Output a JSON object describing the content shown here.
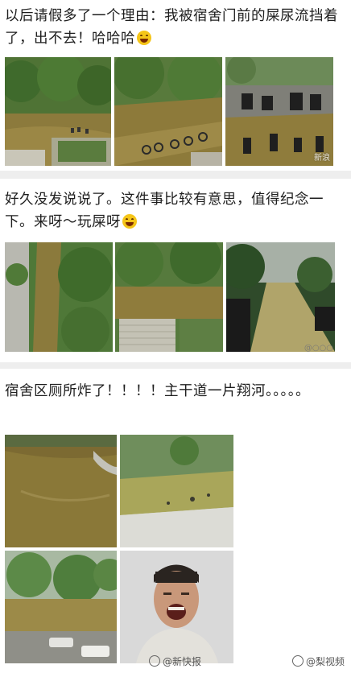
{
  "posts": [
    {
      "text": "以后请假多了一个理由：我被宿舍门前的屎尿流挡着了，出不去！哈哈哈",
      "emoji": "laughing-tears-emoji"
    },
    {
      "text": "好久没发说说了。这件事比较有意思，值得纪念一下。来呀～玩屎呀",
      "emoji": "laughing-emoji"
    },
    {
      "text": "宿舍区厕所炸了！！！！主干道一片翔河。。。。。"
    }
  ],
  "watermarks": {
    "photo3": "新浪",
    "post2": "@○○○"
  },
  "footer": {
    "left": "@新快报",
    "right": "@梨视频"
  },
  "colors": {
    "flood_water": "#8a7a3a",
    "foliage": "#4a7a3a",
    "page_bg": "#eeeeee",
    "card_bg": "#ffffff"
  }
}
